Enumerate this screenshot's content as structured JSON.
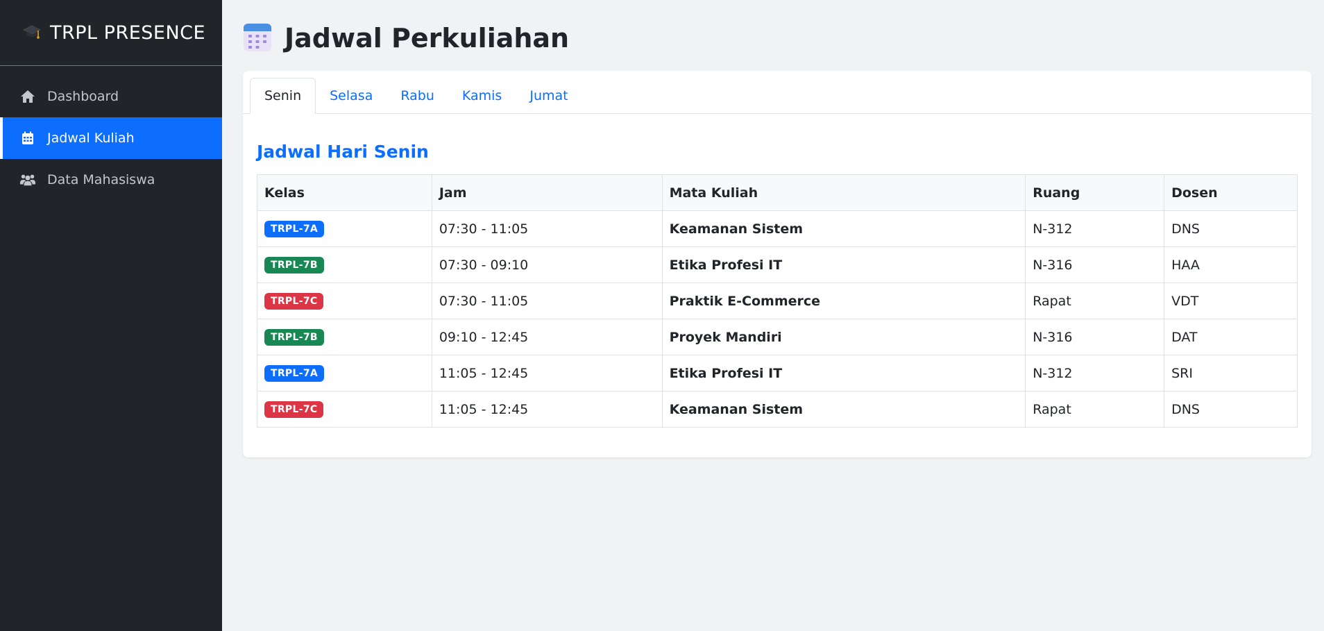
{
  "app": {
    "brand": "TRPL PRESENCE",
    "brand_icon": "graduation-cap-icon"
  },
  "sidebar": {
    "items": [
      {
        "label": "Dashboard",
        "icon": "home-icon",
        "active": false
      },
      {
        "label": "Jadwal Kuliah",
        "icon": "calendar-icon",
        "active": true
      },
      {
        "label": "Data Mahasiswa",
        "icon": "users-icon",
        "active": false
      }
    ]
  },
  "page": {
    "title": "Jadwal Perkuliahan",
    "title_icon": "calendar-icon"
  },
  "tabs": [
    "Senin",
    "Selasa",
    "Rabu",
    "Kamis",
    "Jumat"
  ],
  "active_tab": "Senin",
  "schedule": {
    "title": "Jadwal Hari Senin",
    "headers": [
      "Kelas",
      "Jam",
      "Mata Kuliah",
      "Ruang",
      "Dosen"
    ],
    "rows": [
      {
        "kelas": "TRPL-7A",
        "jam": "07:30 - 11:05",
        "matkul": "Keamanan Sistem",
        "ruang": "N-312",
        "dosen": "DNS"
      },
      {
        "kelas": "TRPL-7B",
        "jam": "07:30 - 09:10",
        "matkul": "Etika Profesi IT",
        "ruang": "N-316",
        "dosen": "HAA"
      },
      {
        "kelas": "TRPL-7C",
        "jam": "07:30 - 11:05",
        "matkul": "Praktik E-Commerce",
        "ruang": "Rapat",
        "dosen": "VDT"
      },
      {
        "kelas": "TRPL-7B",
        "jam": "09:10 - 12:45",
        "matkul": "Proyek Mandiri",
        "ruang": "N-316",
        "dosen": "DAT"
      },
      {
        "kelas": "TRPL-7A",
        "jam": "11:05 - 12:45",
        "matkul": "Etika Profesi IT",
        "ruang": "N-312",
        "dosen": "SRI"
      },
      {
        "kelas": "TRPL-7C",
        "jam": "11:05 - 12:45",
        "matkul": "Keamanan Sistem",
        "ruang": "Rapat",
        "dosen": "DNS"
      }
    ]
  },
  "colors": {
    "TRPL-7A": "#0d6efd",
    "TRPL-7B": "#198754",
    "TRPL-7C": "#dc3545",
    "accent": "#0d6efd",
    "sidebar_bg": "#212529"
  }
}
